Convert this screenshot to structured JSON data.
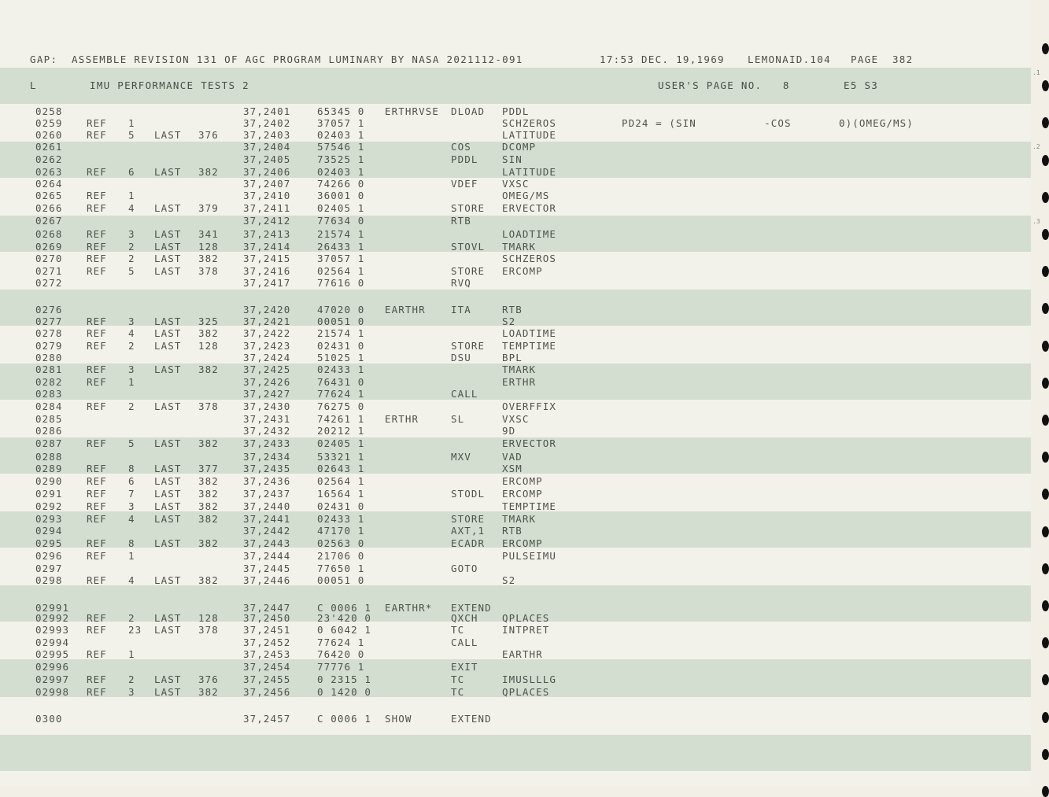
{
  "header": {
    "gap_line": "GAP:  ASSEMBLE REVISION 131 OF AGC PROGRAM LUMINARY BY NASA 2021112-091",
    "timestamp": "17:53 DEC. 19,1969",
    "build": "LEMONAID.104",
    "page": "PAGE  382",
    "sub_l": "L",
    "section": "IMU PERFORMANCE TESTS 2",
    "users_page": "USER'S PAGE NO.   8",
    "ref_code": "E5 S3"
  },
  "margin_marks": [
    ".1",
    ".2",
    ".3"
  ],
  "rows": [
    {
      "line": "0258",
      "ref": "",
      "n": "",
      "last": "",
      "p": "",
      "addr": "37,2401",
      "word": "65345 0",
      "lbl": "ERTHRVSE",
      "op": "DLOAD",
      "arg": "PDDL",
      "cmt": ""
    },
    {
      "line": "0259",
      "ref": "REF",
      "n": "1",
      "last": "",
      "p": "",
      "addr": "37,2402",
      "word": "37057 1",
      "lbl": "",
      "op": "",
      "arg": "SCHZEROS",
      "cmt": "PD24 = (SIN          -COS       0)(OMEG/MS)"
    },
    {
      "line": "0260",
      "ref": "REF",
      "n": "5",
      "last": "LAST",
      "p": "376",
      "addr": "37,2403",
      "word": "02403 1",
      "lbl": "",
      "op": "",
      "arg": "LATITUDE",
      "cmt": ""
    },
    {
      "line": "0261",
      "ref": "",
      "n": "",
      "last": "",
      "p": "",
      "addr": "37,2404",
      "word": "57546 1",
      "lbl": "",
      "op": "COS",
      "arg": "DCOMP",
      "cmt": ""
    },
    {
      "line": "0262",
      "ref": "",
      "n": "",
      "last": "",
      "p": "",
      "addr": "37,2405",
      "word": "73525 1",
      "lbl": "",
      "op": "PDDL",
      "arg": "SIN",
      "cmt": ""
    },
    {
      "line": "0263",
      "ref": "REF",
      "n": "6",
      "last": "LAST",
      "p": "382",
      "addr": "37,2406",
      "word": "02403 1",
      "lbl": "",
      "op": "",
      "arg": "LATITUDE",
      "cmt": ""
    },
    {
      "line": "0264",
      "ref": "",
      "n": "",
      "last": "",
      "p": "",
      "addr": "37,2407",
      "word": "74266 0",
      "lbl": "",
      "op": "VDEF",
      "arg": "VXSC",
      "cmt": ""
    },
    {
      "line": "0265",
      "ref": "REF",
      "n": "1",
      "last": "",
      "p": "",
      "addr": "37,2410",
      "word": "36001 0",
      "lbl": "",
      "op": "",
      "arg": "OMEG/MS",
      "cmt": ""
    },
    {
      "line": "0266",
      "ref": "REF",
      "n": "4",
      "last": "LAST",
      "p": "379",
      "addr": "37,2411",
      "word": "02405 1",
      "lbl": "",
      "op": "STORE",
      "arg": "ERVECTOR",
      "cmt": ""
    },
    {
      "line": "0267",
      "ref": "",
      "n": "",
      "last": "",
      "p": "",
      "addr": "37,2412",
      "word": "77634 0",
      "lbl": "",
      "op": "RTB",
      "arg": "",
      "cmt": ""
    },
    {
      "line": "0268",
      "ref": "REF",
      "n": "3",
      "last": "LAST",
      "p": "341",
      "addr": "37,2413",
      "word": "21574 1",
      "lbl": "",
      "op": "",
      "arg": "LOADTIME",
      "cmt": ""
    },
    {
      "line": "0269",
      "ref": "REF",
      "n": "2",
      "last": "LAST",
      "p": "128",
      "addr": "37,2414",
      "word": "26433 1",
      "lbl": "",
      "op": "STOVL",
      "arg": "TMARK",
      "cmt": ""
    },
    {
      "line": "0270",
      "ref": "REF",
      "n": "2",
      "last": "LAST",
      "p": "382",
      "addr": "37,2415",
      "word": "37057 1",
      "lbl": "",
      "op": "",
      "arg": "SCHZEROS",
      "cmt": ""
    },
    {
      "line": "0271",
      "ref": "REF",
      "n": "5",
      "last": "LAST",
      "p": "378",
      "addr": "37,2416",
      "word": "02564 1",
      "lbl": "",
      "op": "STORE",
      "arg": "ERCOMP",
      "cmt": ""
    },
    {
      "line": "0272",
      "ref": "",
      "n": "",
      "last": "",
      "p": "",
      "addr": "37,2417",
      "word": "77616 0",
      "lbl": "",
      "op": "RVQ",
      "arg": "",
      "cmt": ""
    },
    {
      "line": "0276",
      "ref": "",
      "n": "",
      "last": "",
      "p": "",
      "addr": "37,2420",
      "word": "47020 0",
      "lbl": "EARTHR",
      "op": "ITA",
      "arg": "RTB",
      "cmt": ""
    },
    {
      "line": "0277",
      "ref": "REF",
      "n": "3",
      "last": "LAST",
      "p": "325",
      "addr": "37,2421",
      "word": "00051 0",
      "lbl": "",
      "op": "",
      "arg": "S2",
      "cmt": ""
    },
    {
      "line": "0278",
      "ref": "REF",
      "n": "4",
      "last": "LAST",
      "p": "382",
      "addr": "37,2422",
      "word": "21574 1",
      "lbl": "",
      "op": "",
      "arg": "LOADTIME",
      "cmt": ""
    },
    {
      "line": "0279",
      "ref": "REF",
      "n": "2",
      "last": "LAST",
      "p": "128",
      "addr": "37,2423",
      "word": "02431 0",
      "lbl": "",
      "op": "STORE",
      "arg": "TEMPTIME",
      "cmt": ""
    },
    {
      "line": "0280",
      "ref": "",
      "n": "",
      "last": "",
      "p": "",
      "addr": "37,2424",
      "word": "51025 1",
      "lbl": "",
      "op": "DSU",
      "arg": "BPL",
      "cmt": ""
    },
    {
      "line": "0281",
      "ref": "REF",
      "n": "3",
      "last": "LAST",
      "p": "382",
      "addr": "37,2425",
      "word": "02433 1",
      "lbl": "",
      "op": "",
      "arg": "TMARK",
      "cmt": ""
    },
    {
      "line": "0282",
      "ref": "REF",
      "n": "1",
      "last": "",
      "p": "",
      "addr": "37,2426",
      "word": "76431 0",
      "lbl": "",
      "op": "",
      "arg": "ERTHR",
      "cmt": ""
    },
    {
      "line": "0283",
      "ref": "",
      "n": "",
      "last": "",
      "p": "",
      "addr": "37,2427",
      "word": "77624 1",
      "lbl": "",
      "op": "CALL",
      "arg": "",
      "cmt": ""
    },
    {
      "line": "0284",
      "ref": "REF",
      "n": "2",
      "last": "LAST",
      "p": "378",
      "addr": "37,2430",
      "word": "76275 0",
      "lbl": "",
      "op": "",
      "arg": "OVERFFIX",
      "cmt": ""
    },
    {
      "line": "0285",
      "ref": "",
      "n": "",
      "last": "",
      "p": "",
      "addr": "37,2431",
      "word": "74261 1",
      "lbl": "ERTHR",
      "op": "SL",
      "arg": "VXSC",
      "cmt": ""
    },
    {
      "line": "0286",
      "ref": "",
      "n": "",
      "last": "",
      "p": "",
      "addr": "37,2432",
      "word": "20212 1",
      "lbl": "",
      "op": "",
      "arg": "9D",
      "cmt": ""
    },
    {
      "line": "0287",
      "ref": "REF",
      "n": "5",
      "last": "LAST",
      "p": "382",
      "addr": "37,2433",
      "word": "02405 1",
      "lbl": "",
      "op": "",
      "arg": "ERVECTOR",
      "cmt": ""
    },
    {
      "line": "0288",
      "ref": "",
      "n": "",
      "last": "",
      "p": "",
      "addr": "37,2434",
      "word": "53321 1",
      "lbl": "",
      "op": "MXV",
      "arg": "VAD",
      "cmt": ""
    },
    {
      "line": "0289",
      "ref": "REF",
      "n": "8",
      "last": "LAST",
      "p": "377",
      "addr": "37,2435",
      "word": "02643 1",
      "lbl": "",
      "op": "",
      "arg": "XSM",
      "cmt": ""
    },
    {
      "line": "0290",
      "ref": "REF",
      "n": "6",
      "last": "LAST",
      "p": "382",
      "addr": "37,2436",
      "word": "02564 1",
      "lbl": "",
      "op": "",
      "arg": "ERCOMP",
      "cmt": ""
    },
    {
      "line": "0291",
      "ref": "REF",
      "n": "7",
      "last": "LAST",
      "p": "382",
      "addr": "37,2437",
      "word": "16564 1",
      "lbl": "",
      "op": "STODL",
      "arg": "ERCOMP",
      "cmt": ""
    },
    {
      "line": "0292",
      "ref": "REF",
      "n": "3",
      "last": "LAST",
      "p": "382",
      "addr": "37,2440",
      "word": "02431 0",
      "lbl": "",
      "op": "",
      "arg": "TEMPTIME",
      "cmt": ""
    },
    {
      "line": "0293",
      "ref": "REF",
      "n": "4",
      "last": "LAST",
      "p": "382",
      "addr": "37,2441",
      "word": "02433 1",
      "lbl": "",
      "op": "STORE",
      "arg": "TMARK",
      "cmt": ""
    },
    {
      "line": "0294",
      "ref": "",
      "n": "",
      "last": "",
      "p": "",
      "addr": "37,2442",
      "word": "47170 1",
      "lbl": "",
      "op": "AXT,1",
      "arg": "RTB",
      "cmt": ""
    },
    {
      "line": "0295",
      "ref": "REF",
      "n": "8",
      "last": "LAST",
      "p": "382",
      "addr": "37,2443",
      "word": "02563 0",
      "lbl": "",
      "op": "ECADR",
      "arg": "ERCOMP",
      "cmt": ""
    },
    {
      "line": "0296",
      "ref": "REF",
      "n": "1",
      "last": "",
      "p": "",
      "addr": "37,2444",
      "word": "21706 0",
      "lbl": "",
      "op": "",
      "arg": "PULSEIMU",
      "cmt": ""
    },
    {
      "line": "0297",
      "ref": "",
      "n": "",
      "last": "",
      "p": "",
      "addr": "37,2445",
      "word": "77650 1",
      "lbl": "",
      "op": "GOTO",
      "arg": "",
      "cmt": ""
    },
    {
      "line": "0298",
      "ref": "REF",
      "n": "4",
      "last": "LAST",
      "p": "382",
      "addr": "37,2446",
      "word": "00051 0",
      "lbl": "",
      "op": "",
      "arg": "S2",
      "cmt": ""
    },
    {
      "line": "02991",
      "ref": "",
      "n": "",
      "last": "",
      "p": "",
      "addr": "37,2447",
      "word": "C 0006 1",
      "lbl": "EARTHR*",
      "op": "EXTEND",
      "arg": "",
      "cmt": ""
    },
    {
      "line": "02992",
      "ref": "REF",
      "n": "2",
      "last": "LAST",
      "p": "128",
      "addr": "37,2450",
      "word": "23'420 0",
      "lbl": "",
      "op": "QXCH",
      "arg": "QPLACES",
      "cmt": ""
    },
    {
      "line": "02993",
      "ref": "REF",
      "n": "23",
      "last": "LAST",
      "p": "378",
      "addr": "37,2451",
      "word": "0 6042 1",
      "lbl": "",
      "op": "TC",
      "arg": "INTPRET",
      "cmt": ""
    },
    {
      "line": "02994",
      "ref": "",
      "n": "",
      "last": "",
      "p": "",
      "addr": "37,2452",
      "word": "77624 1",
      "lbl": "",
      "op": "CALL",
      "arg": "",
      "cmt": ""
    },
    {
      "line": "02995",
      "ref": "REF",
      "n": "1",
      "last": "",
      "p": "",
      "addr": "37,2453",
      "word": "76420 0",
      "lbl": "",
      "op": "",
      "arg": "EARTHR",
      "cmt": ""
    },
    {
      "line": "02996",
      "ref": "",
      "n": "",
      "last": "",
      "p": "",
      "addr": "37,2454",
      "word": "77776 1",
      "lbl": "",
      "op": "EXIT",
      "arg": "",
      "cmt": ""
    },
    {
      "line": "02997",
      "ref": "REF",
      "n": "2",
      "last": "LAST",
      "p": "376",
      "addr": "37,2455",
      "word": "0 2315 1",
      "lbl": "",
      "op": "TC",
      "arg": "IMUSLLLG",
      "cmt": ""
    },
    {
      "line": "02998",
      "ref": "REF",
      "n": "3",
      "last": "LAST",
      "p": "382",
      "addr": "37,2456",
      "word": "0 1420 0",
      "lbl": "",
      "op": "TC",
      "arg": "QPLACES",
      "cmt": ""
    },
    {
      "line": "0300",
      "ref": "",
      "n": "",
      "last": "",
      "p": "",
      "addr": "37,2457",
      "word": "C 0006 1",
      "lbl": "SHOW",
      "op": "EXTEND",
      "arg": "",
      "cmt": ""
    }
  ]
}
